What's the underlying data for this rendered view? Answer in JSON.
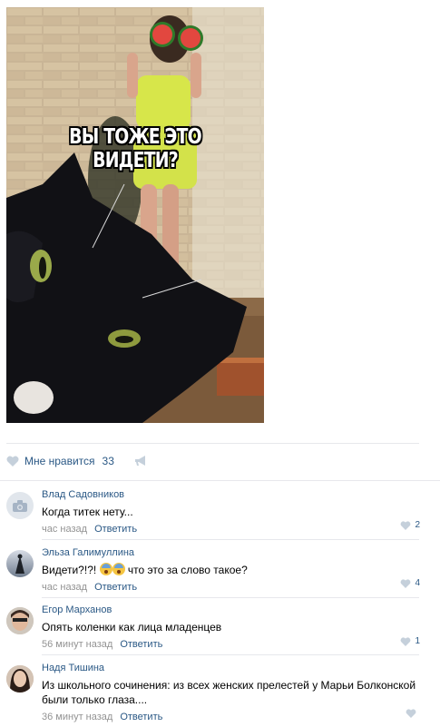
{
  "post": {
    "image_caption": "ВЫ ТОЖЕ ЭТО ВИДЕТИ?",
    "like_label": "Мне нравится",
    "like_count": "33"
  },
  "comments": [
    {
      "author": "Влад Садовников",
      "text": "Когда титек нету...",
      "time": "час назад",
      "reply": "Ответить",
      "likes": "2"
    },
    {
      "author": "Эльза Галимуллина",
      "text_prefix": "Видети?!?!",
      "text_suffix": " что это за слово такое?",
      "time": "час назад",
      "reply": "Ответить",
      "likes": "4"
    },
    {
      "author": "Егор Марханов",
      "text": "Опять коленки как лица младенцев",
      "time": "56 минут назад",
      "reply": "Ответить",
      "likes": "1"
    },
    {
      "author": "Надя Тишина",
      "text": "Из школьного сочинения: из всех женских прелестей у Марьи Болконской были только глаза....",
      "time": "36 минут назад",
      "reply": "Ответить",
      "likes": ""
    }
  ],
  "icons": {
    "like": "heart-icon",
    "share": "megaphone-icon",
    "camera": "camera-icon"
  },
  "colors": {
    "link": "#2a5885",
    "meta": "#939393",
    "divider": "#e7e8ec",
    "heart": "#c5d0db"
  }
}
